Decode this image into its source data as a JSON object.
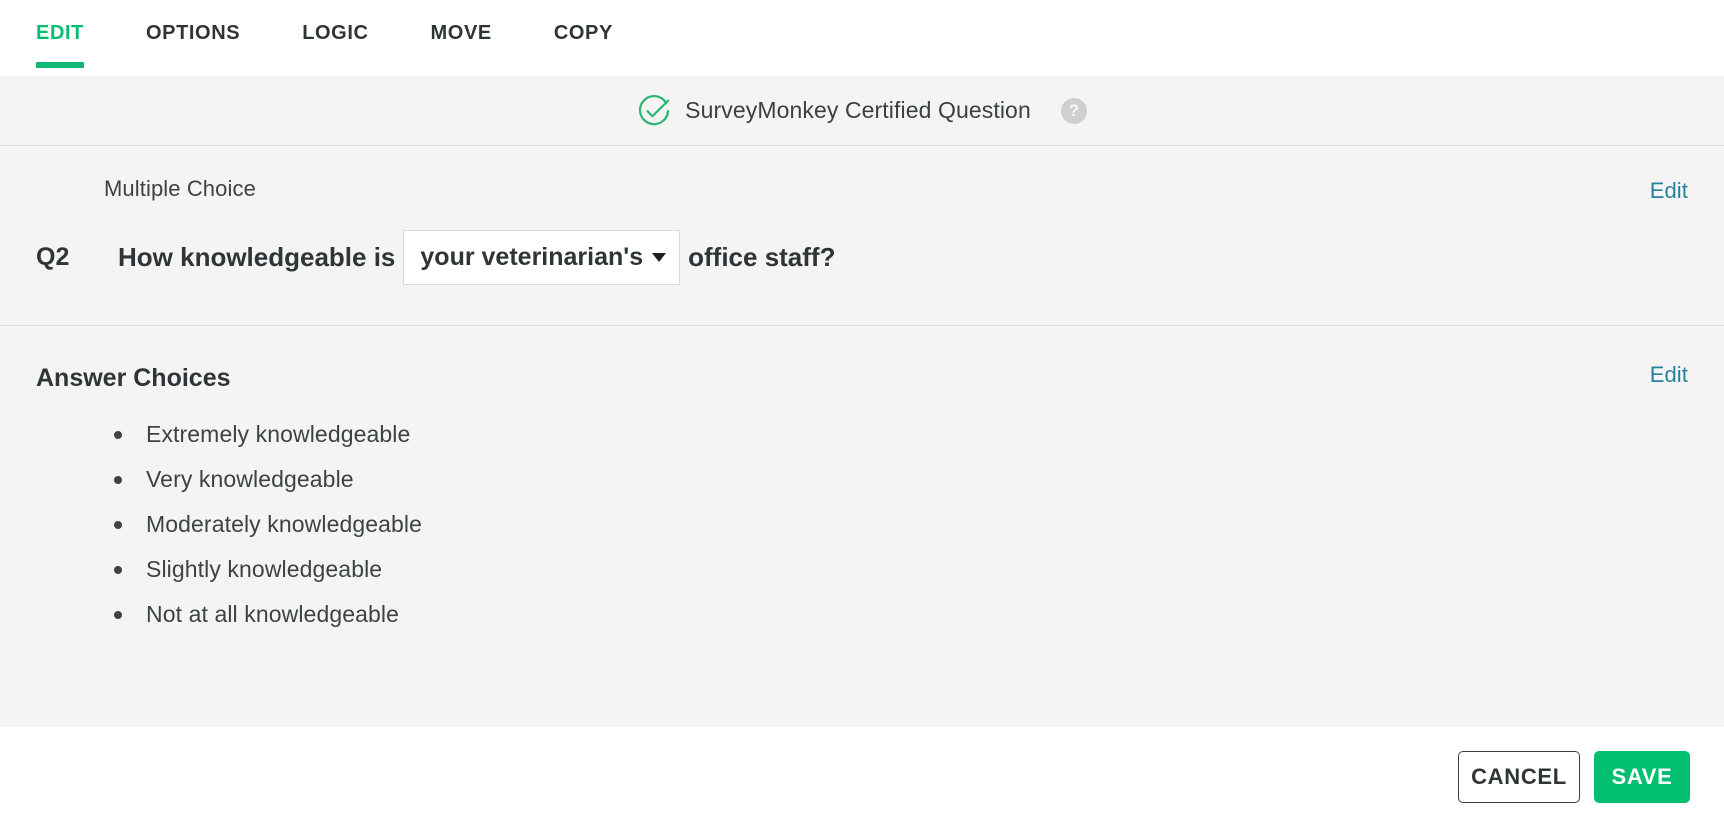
{
  "tabs": [
    {
      "label": "EDIT",
      "active": true
    },
    {
      "label": "OPTIONS",
      "active": false
    },
    {
      "label": "LOGIC",
      "active": false
    },
    {
      "label": "MOVE",
      "active": false
    },
    {
      "label": "COPY",
      "active": false
    }
  ],
  "certified_banner": {
    "icon": "check-circle-icon",
    "label": "SurveyMonkey Certified Question",
    "help_icon": "help-icon",
    "help_glyph": "?"
  },
  "question": {
    "type_label": "Multiple Choice",
    "number": "Q2",
    "text_before": "How knowledgeable is",
    "piped_value": "your veterinarian's",
    "text_after": "office staff?",
    "edit_label": "Edit"
  },
  "answer_choices": {
    "title": "Answer Choices",
    "edit_label": "Edit",
    "items": [
      "Extremely knowledgeable",
      "Very knowledgeable",
      "Moderately knowledgeable",
      "Slightly knowledgeable",
      "Not at all knowledgeable"
    ]
  },
  "footer": {
    "cancel_label": "CANCEL",
    "save_label": "SAVE"
  },
  "colors": {
    "accent_green": "#00bf6f",
    "tab_underline": "#13b877",
    "link_blue": "#2a7f9e",
    "page_bg": "#f4f4f4",
    "text_dark": "#2f3437"
  }
}
